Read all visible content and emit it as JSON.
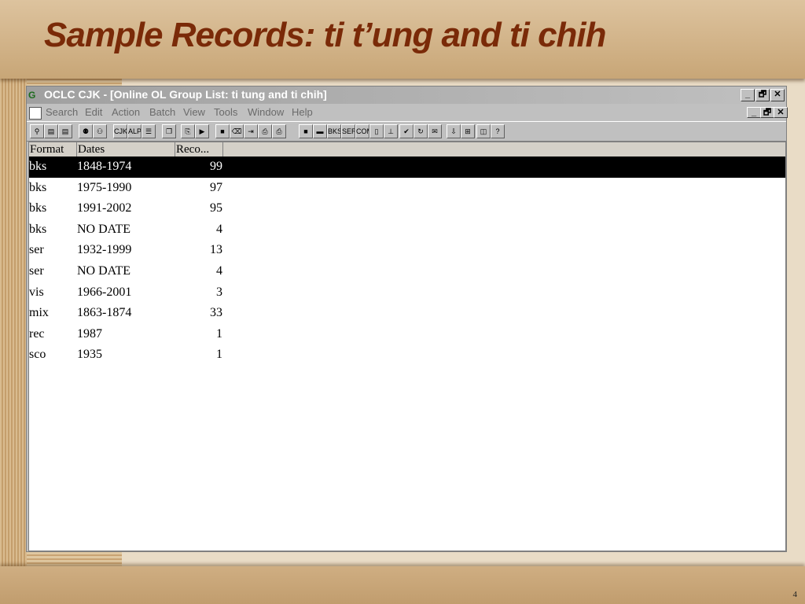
{
  "slide": {
    "title": "Sample Records: ti t’ung and ti chih",
    "page_number": "4"
  },
  "window": {
    "title": "OCLC CJK - [Online OL Group List: ti tung and ti chih]",
    "controls": [
      "_",
      "🗗",
      "✕"
    ],
    "icon": "oclc-cjk-app-icon"
  },
  "menu": {
    "items": [
      {
        "label": "Search"
      },
      {
        "label": "Edit"
      },
      {
        "label": "Action"
      },
      {
        "label": "Batch"
      },
      {
        "label": "View"
      },
      {
        "label": "Tools"
      },
      {
        "label": "Window"
      },
      {
        "label": "Help"
      }
    ],
    "doc_controls": [
      "_",
      "🗗",
      "✕"
    ]
  },
  "toolbar": {
    "buttons": [
      {
        "name": "search-tool-icon",
        "glyph": "⚲"
      },
      {
        "name": "local-file-icon",
        "glyph": "▤"
      },
      {
        "name": "online-file-icon",
        "glyph": "▤"
      },
      {
        "name": "group-search-icon",
        "glyph": "⚉"
      },
      {
        "name": "group-list-icon",
        "glyph": "⚇"
      },
      {
        "name": "cjk-entry-icon",
        "glyph": "CJK"
      },
      {
        "name": "alpha-entry-icon",
        "glyph": "ALP"
      },
      {
        "name": "text-list-icon",
        "glyph": "☰"
      },
      {
        "name": "copy-record-icon",
        "glyph": "❐"
      },
      {
        "name": "save-record-icon",
        "glyph": "⎘"
      },
      {
        "name": "next-record-icon",
        "glyph": "▶"
      },
      {
        "name": "stop-icon",
        "glyph": "■"
      },
      {
        "name": "delete-icon",
        "glyph": "⌫"
      },
      {
        "name": "export-icon",
        "glyph": "⇥"
      },
      {
        "name": "print-icon",
        "glyph": "⎙"
      },
      {
        "name": "print-label-icon",
        "glyph": "⎙"
      },
      {
        "name": "bib-workform-icon",
        "glyph": "■"
      },
      {
        "name": "display-icon",
        "glyph": "▬"
      },
      {
        "name": "bks-workform-icon",
        "glyph": "BKS"
      },
      {
        "name": "ser-workform-icon",
        "glyph": "SER"
      },
      {
        "name": "com-workform-icon",
        "glyph": "COM"
      },
      {
        "name": "blank-page-icon",
        "glyph": "▯"
      },
      {
        "name": "split-icon",
        "glyph": "⊥"
      },
      {
        "name": "validate-icon",
        "glyph": "✔"
      },
      {
        "name": "reformat-icon",
        "glyph": "↻"
      },
      {
        "name": "message-icon",
        "glyph": "✉"
      },
      {
        "name": "download-icon",
        "glyph": "⇩"
      },
      {
        "name": "link-icon",
        "glyph": "⊞"
      },
      {
        "name": "window-icon",
        "glyph": "◫"
      },
      {
        "name": "help-icon",
        "glyph": "?"
      }
    ]
  },
  "list": {
    "columns": [
      "Format",
      "Dates",
      "Reco..."
    ],
    "rows": [
      {
        "format": "bks",
        "dates": "1848-1974",
        "records": "99",
        "selected": true
      },
      {
        "format": "bks",
        "dates": "1975-1990",
        "records": "97"
      },
      {
        "format": "bks",
        "dates": "1991-2002",
        "records": "95"
      },
      {
        "format": "bks",
        "dates": "NO DATE",
        "records": "4"
      },
      {
        "format": "ser",
        "dates": "1932-1999",
        "records": "13"
      },
      {
        "format": "ser",
        "dates": "NO DATE",
        "records": "4"
      },
      {
        "format": "vis",
        "dates": "1966-2001",
        "records": "3"
      },
      {
        "format": "mix",
        "dates": "1863-1874",
        "records": "33"
      },
      {
        "format": "rec",
        "dates": "1987",
        "records": "1"
      },
      {
        "format": "sco",
        "dates": "1935",
        "records": "1"
      }
    ]
  },
  "colors": {
    "title_text": "#7a2a08",
    "selection": "#000000",
    "window_chrome": "#c0c0c0"
  }
}
